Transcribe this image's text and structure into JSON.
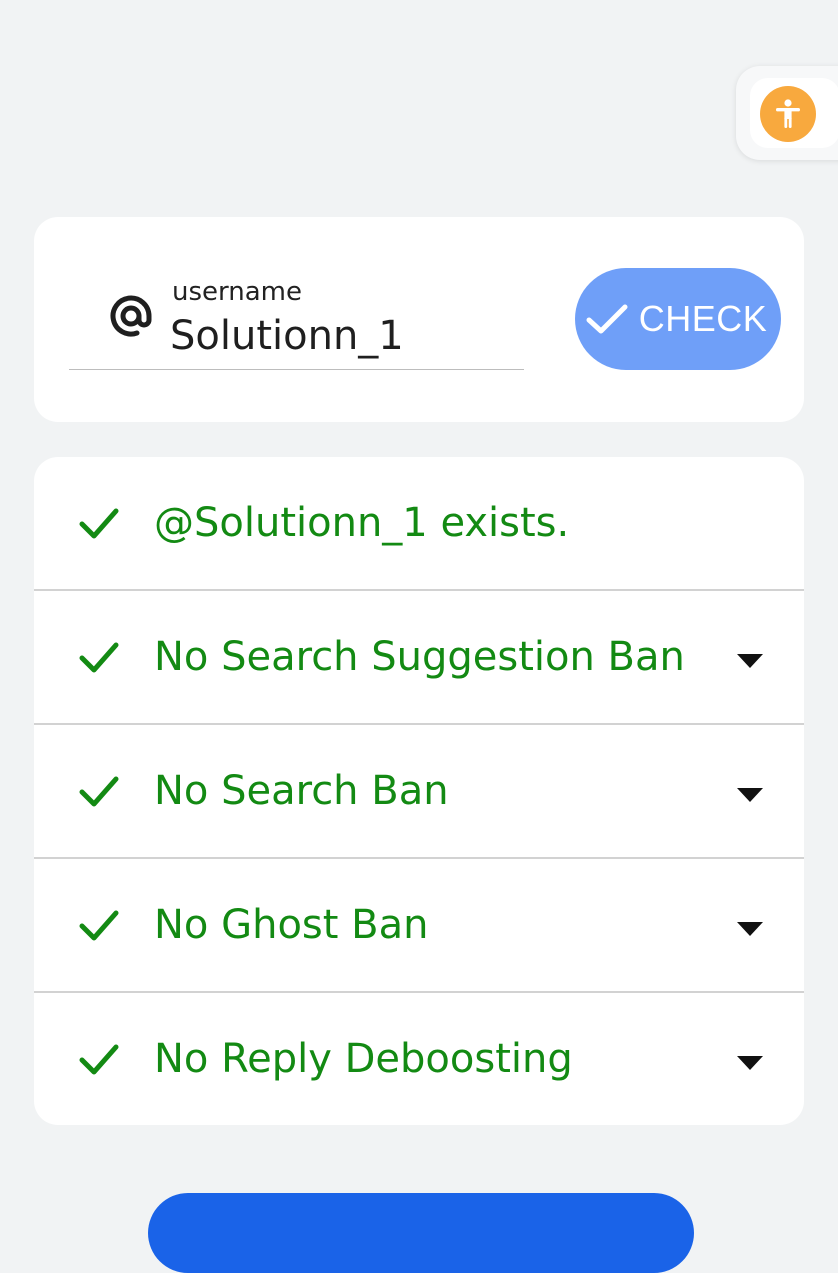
{
  "accessibility": {
    "icon": "accessibility-icon",
    "color": "#f8a93e"
  },
  "search": {
    "at_icon": "at-sign-icon",
    "label": "username",
    "value": "Solutionn_1",
    "button": {
      "label": "CHECK",
      "icon": "check-icon",
      "color": "#6f9ff8"
    }
  },
  "results": {
    "status_color": "#138a13",
    "items": [
      {
        "label": "@Solutionn_1 exists.",
        "icon": "check-icon",
        "expandable": false
      },
      {
        "label": "No Search Suggestion Ban",
        "icon": "check-icon",
        "expandable": true
      },
      {
        "label": "No Search Ban",
        "icon": "check-icon",
        "expandable": true
      },
      {
        "label": "No Ghost Ban",
        "icon": "check-icon",
        "expandable": true
      },
      {
        "label": "No Reply Deboosting",
        "icon": "check-icon",
        "expandable": true
      }
    ]
  },
  "bottom_button": {
    "color": "#1a63e8"
  }
}
